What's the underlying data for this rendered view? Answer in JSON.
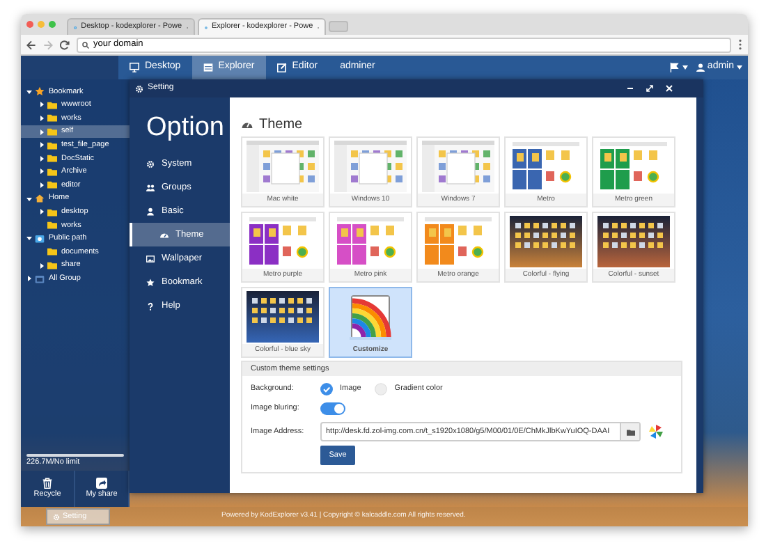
{
  "browser": {
    "tabs": [
      {
        "title": "Desktop - kodexplorer - Powe",
        "selected": false
      },
      {
        "title": "Explorer - kodexplorer - Powe",
        "selected": true
      }
    ],
    "address": "your domain"
  },
  "nav": {
    "items": [
      {
        "label": "Desktop",
        "kind": "monitor",
        "selected": false
      },
      {
        "label": "Explorer",
        "kind": "window",
        "selected": true
      },
      {
        "label": "Editor",
        "kind": "edit",
        "selected": false
      },
      {
        "label": "adminer",
        "selected": false
      }
    ],
    "user": "admin"
  },
  "tree": [
    {
      "label": "Bookmark",
      "kind": "star",
      "expanded": true,
      "selected": false,
      "children": [
        {
          "label": "wwwroot",
          "kind": "folder",
          "expanded": false,
          "selected": false
        },
        {
          "label": "works",
          "kind": "folder",
          "expanded": false,
          "selected": false
        },
        {
          "label": "self",
          "kind": "folder",
          "expanded": false,
          "selected": true
        },
        {
          "label": "test_file_page",
          "kind": "folder",
          "expanded": false,
          "selected": false
        },
        {
          "label": "DocStatic",
          "kind": "folder",
          "expanded": false,
          "selected": false
        },
        {
          "label": "Archive",
          "kind": "folder",
          "expanded": false,
          "selected": false
        },
        {
          "label": "editor",
          "kind": "folder",
          "expanded": false,
          "selected": false
        }
      ]
    },
    {
      "label": "Home",
      "kind": "home",
      "expanded": true,
      "selected": false,
      "children": [
        {
          "label": "desktop",
          "kind": "folder",
          "expanded": false,
          "selected": false
        },
        {
          "label": "works",
          "kind": "folder",
          "selected": false
        }
      ]
    },
    {
      "label": "Public path",
      "kind": "public",
      "expanded": true,
      "selected": false,
      "children": [
        {
          "label": "documents",
          "kind": "folder",
          "selected": false
        },
        {
          "label": "share",
          "kind": "folder",
          "expanded": false,
          "selected": false
        }
      ]
    },
    {
      "label": "All Group",
      "kind": "group",
      "expanded": false,
      "selected": false
    }
  ],
  "storage": "226.7M/No limit",
  "dock": [
    {
      "label": "Recycle",
      "kind": "trash"
    },
    {
      "label": "My share",
      "kind": "share"
    }
  ],
  "setting_window": {
    "title": "Setting",
    "heading": "Option",
    "menu": [
      {
        "label": "System",
        "kind": "gear",
        "selected": false
      },
      {
        "label": "Groups",
        "kind": "users",
        "selected": false
      },
      {
        "label": "Basic",
        "kind": "user",
        "selected": false,
        "children": [
          {
            "label": "Theme",
            "kind": "dashboard",
            "selected": true
          }
        ]
      },
      {
        "label": "Wallpaper",
        "kind": "image",
        "selected": false
      },
      {
        "label": "Bookmark",
        "kind": "star",
        "selected": false
      },
      {
        "label": "Help",
        "kind": "question",
        "selected": false
      }
    ],
    "theme_title": "Theme",
    "themes": [
      {
        "label": "Mac white",
        "kind": "window",
        "selected": false
      },
      {
        "label": "Windows 10",
        "kind": "window",
        "selected": false
      },
      {
        "label": "Windows 7",
        "kind": "window",
        "selected": false
      },
      {
        "label": "Metro",
        "kind": "metro",
        "color": "#3a66b0",
        "selected": false
      },
      {
        "label": "Metro green",
        "kind": "metro",
        "color": "#1f9d4c",
        "selected": false
      },
      {
        "label": "Metro purple",
        "kind": "metro",
        "color": "#8b2fc4",
        "selected": false
      },
      {
        "label": "Metro pink",
        "kind": "metro",
        "color": "#d64fc6",
        "selected": false
      },
      {
        "label": "Metro orange",
        "kind": "metro",
        "color": "#f28a1c",
        "selected": false
      },
      {
        "label": "Colorful - flying",
        "kind": "photo",
        "color": "#c9823a",
        "selected": false
      },
      {
        "label": "Colorful - sunset",
        "kind": "photo",
        "color": "#b9653c",
        "selected": false
      },
      {
        "label": "Colorful - blue sky",
        "kind": "photo",
        "color": "#3565b5",
        "selected": false
      },
      {
        "label": "Customize",
        "kind": "custom",
        "selected": true
      }
    ],
    "custom": {
      "title": "Custom theme settings",
      "background_label": "Background:",
      "background_options": [
        {
          "label": "Image",
          "selected": true
        },
        {
          "label": "Gradient color",
          "selected": false
        }
      ],
      "blur_label": "Image bluring:",
      "blur_on": true,
      "address_label": "Image Address:",
      "address_value": "http://desk.fd.zol-img.com.cn/t_s1920x1080/g5/M00/01/0E/ChMkJlbKwYuIOQ-DAAI",
      "save": "Save"
    }
  },
  "taskbar": {
    "button": "Setting"
  },
  "footer": "Powered by KodExplorer v3.41 | Copyright © kalcaddle.com All rights reserved."
}
